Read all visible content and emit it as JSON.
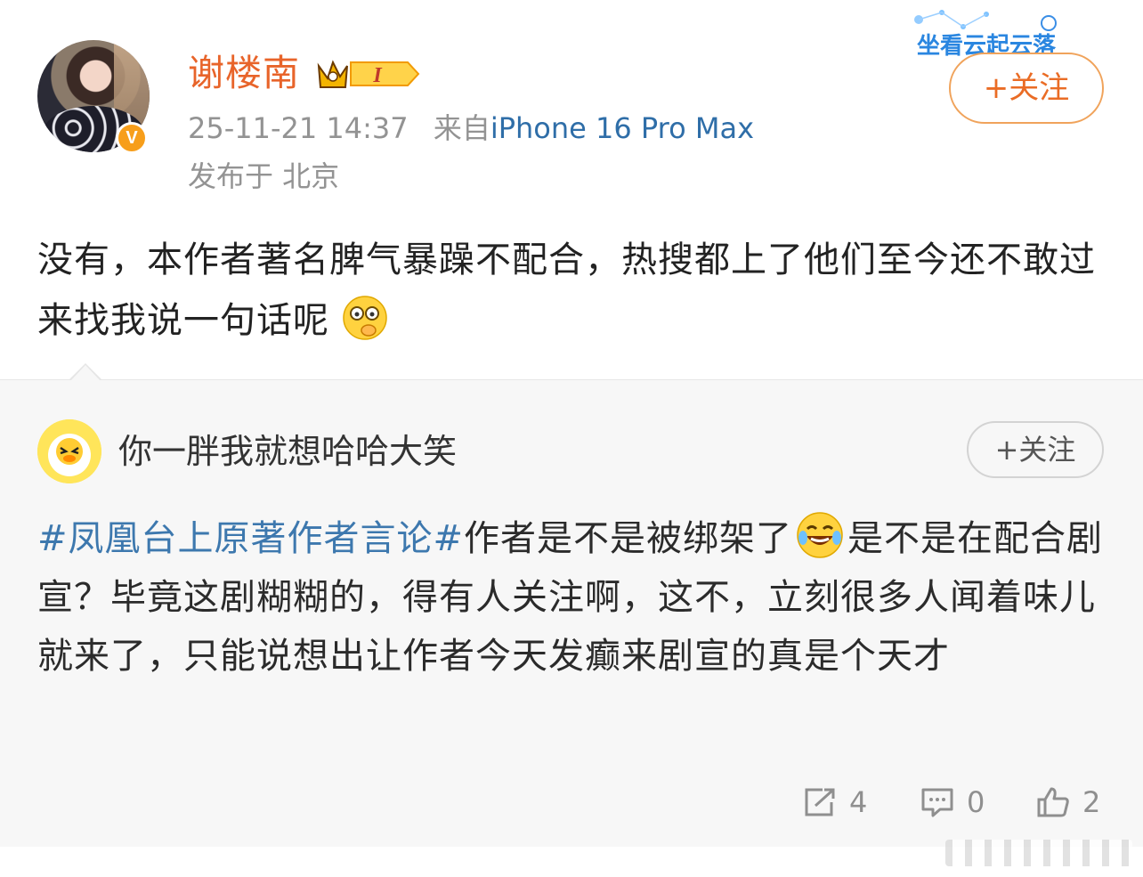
{
  "post": {
    "author_name": "谢楼南",
    "vip_badge_label": "I",
    "verified_label": "V",
    "timestamp": "25-11-21 14:37",
    "source_prefix": "来自",
    "source_device": "iPhone 16 Pro Max",
    "location": "发布于 北京",
    "follow_label": "+关注",
    "banner_text": "坐看云起云落",
    "text": "没有，本作者著名脾气暴躁不配合，热搜都上了他们至今还不敢过来找我说一句话呢",
    "emoji": "facepalm-emoji"
  },
  "repost": {
    "author_name": "你一胖我就想哈哈大笑",
    "follow_label": "+关注",
    "hashtag": "#凤凰台上原著作者言论#",
    "text_before_emoji": "作者是不是被绑架了",
    "emoji": "laugh-cry-emoji",
    "text_after_emoji": "是不是在配合剧宣？毕竟这剧糊糊的，得有人关注啊，这不，立刻很多人闻着味儿就来了，只能说想出让作者今天发癫来剧宣的真是个天才"
  },
  "actions": {
    "repost_count": "4",
    "comment_count": "0",
    "like_count": "2"
  },
  "colors": {
    "author_name": "#e8642a",
    "link_blue": "#3d78ae",
    "follow_orange": "#ea6c25",
    "repost_bg": "#f7f7f7",
    "meta_gray": "#939393"
  }
}
